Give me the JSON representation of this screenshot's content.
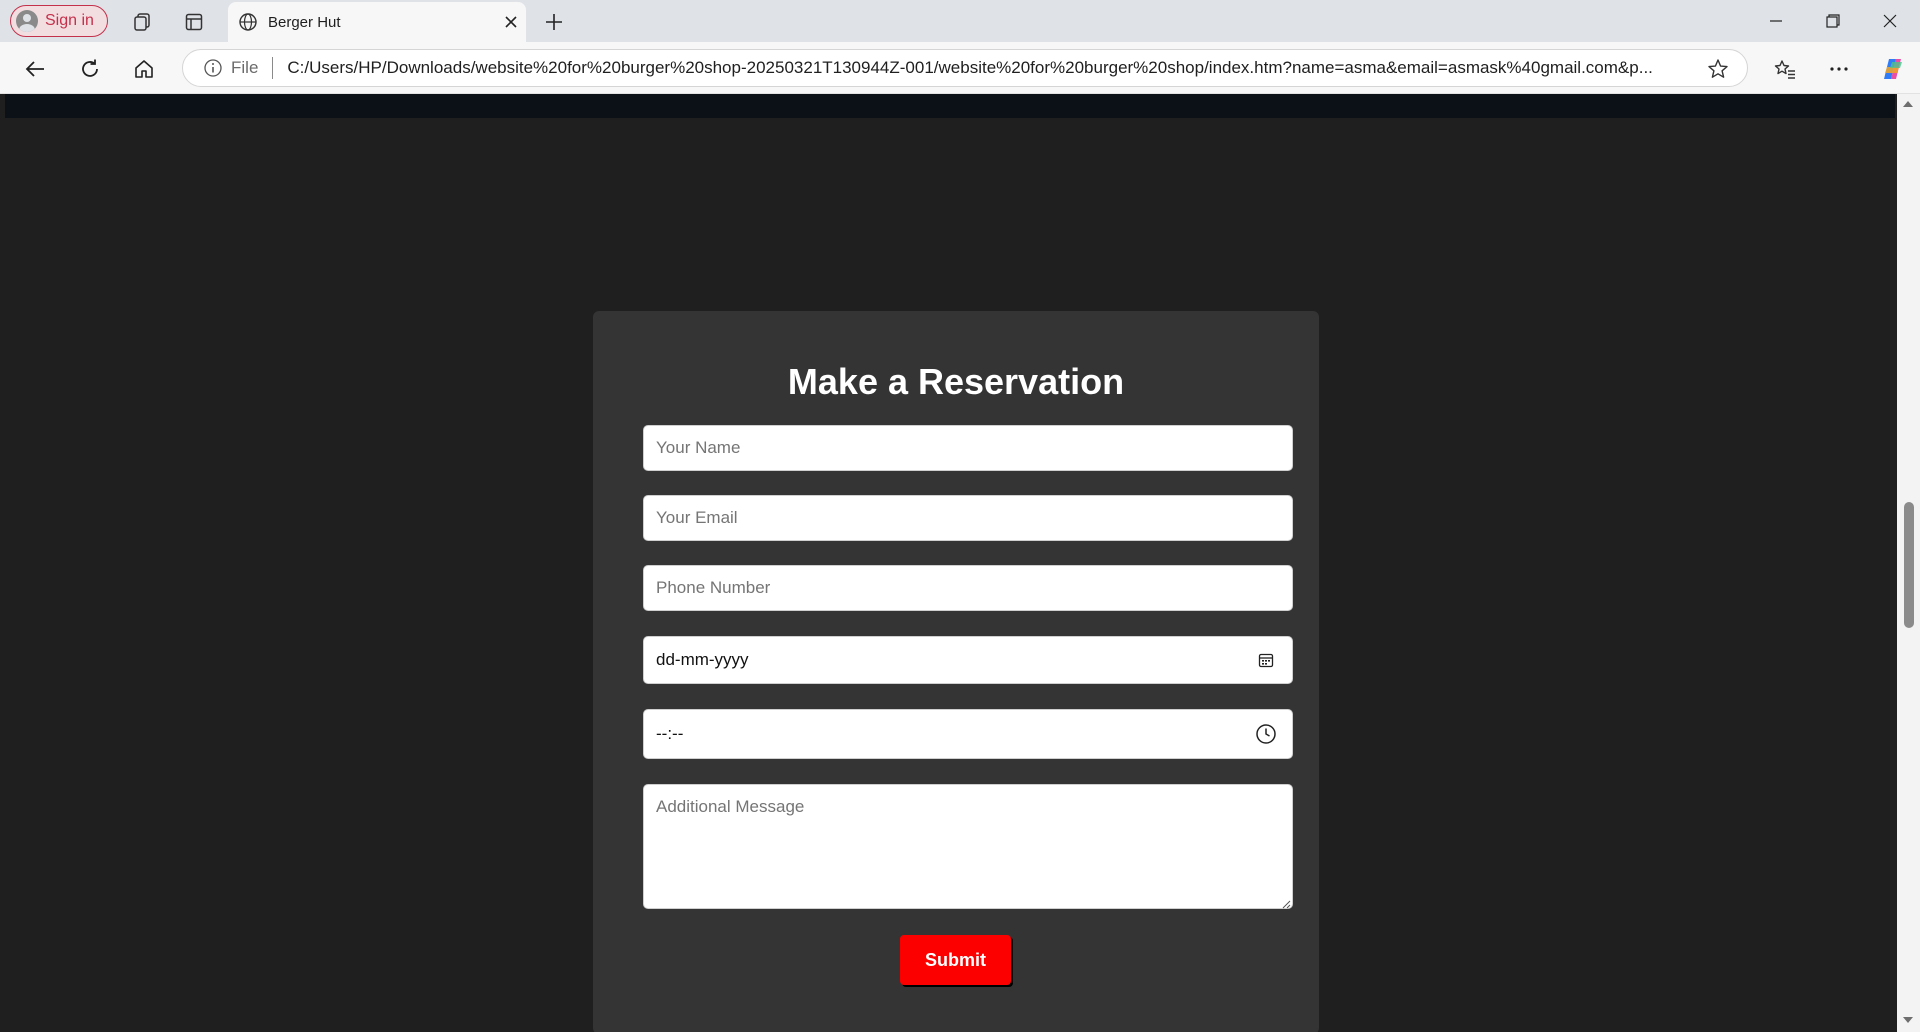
{
  "browser": {
    "signin_label": "Sign in",
    "tab_title": "Berger Hut",
    "address_prefix": "File",
    "url": "C:/Users/HP/Downloads/website%20for%20burger%20shop-20250321T130944Z-001/website%20for%20burger%20shop/index.htm?name=asma&email=asmask%40gmail.com&p...",
    "icons": [
      "profile-icon",
      "collections-icon",
      "tab-actions-icon",
      "globe-icon",
      "close-icon",
      "plus-icon",
      "minimize-icon",
      "restore-icon",
      "close-window-icon",
      "back-icon",
      "refresh-icon",
      "home-icon",
      "info-icon",
      "star-icon",
      "favorites-icon",
      "more-icon",
      "copilot-icon"
    ]
  },
  "form": {
    "title": "Make a Reservation",
    "name_placeholder": "Your Name",
    "email_placeholder": "Your Email",
    "phone_placeholder": "Phone Number",
    "date_value": "dd-mm-yyyy",
    "time_value": "--:--",
    "message_placeholder": "Additional Message",
    "submit_label": "Submit"
  },
  "colors": {
    "page_bg": "#1f1f1f",
    "card_bg": "#343434",
    "submit_bg": "#fc0000",
    "signin_accent": "#c4314b"
  }
}
